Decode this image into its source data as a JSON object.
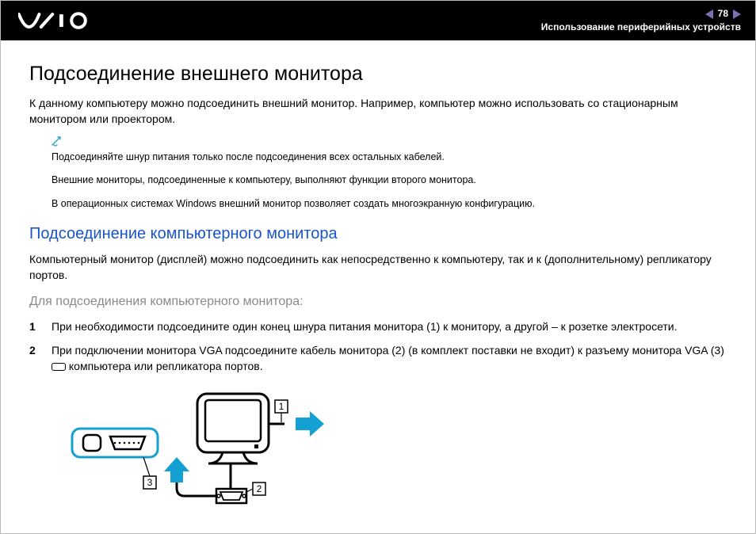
{
  "header": {
    "page_number": "78",
    "breadcrumb": "Использование периферийных устройств"
  },
  "main": {
    "h1": "Подсоединение внешнего монитора",
    "intro": "К данному компьютеру можно подсоединить внешний монитор. Например, компьютер можно использовать со стационарным монитором или проектором.",
    "notes": [
      "Подсоединяйте шнур питания только после подсоединения всех остальных кабелей.",
      "Внешние мониторы, подсоединенные к компьютеру, выполняют функции второго монитора.",
      "В операционных системах Windows внешний монитор позволяет создать многоэкранную конфигурацию."
    ],
    "h2": "Подсоединение компьютерного монитора",
    "p2": "Компьютерный монитор (дисплей) можно подсоединить как непосредственно к компьютеру, так и к (дополнительному) репликатору портов.",
    "h3": "Для подсоединения компьютерного монитора:",
    "steps": [
      "При необходимости подсоедините один конец шнура питания монитора (1) к монитору, а другой – к розетке электросети.",
      "При подключении монитора VGA подсоедините кабель монитора (2) (в комплект поставки не входит) к разъему монитора VGA (3)      компьютера или репликатора портов."
    ],
    "callouts": {
      "c1": "1",
      "c2": "2",
      "c3": "3"
    }
  }
}
